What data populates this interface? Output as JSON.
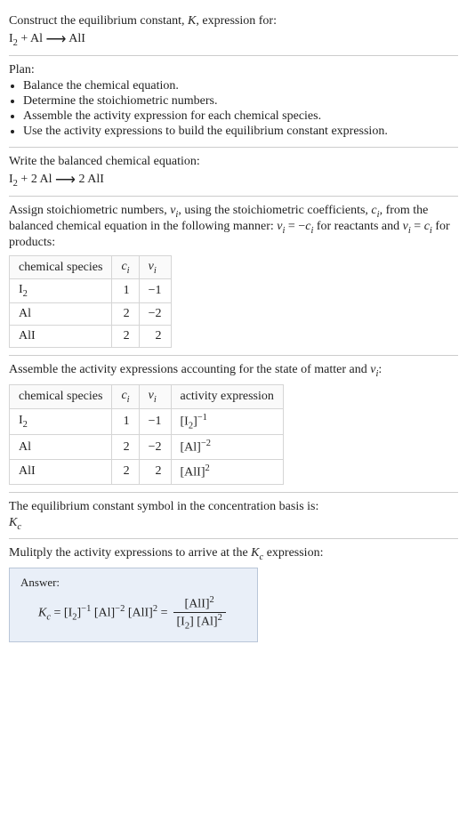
{
  "intro": {
    "line1": "Construct the equilibrium constant, ",
    "K": "K",
    "line1b": ", expression for:",
    "eq_lhs_I2": "I",
    "eq_lhs_sub2": "2",
    "plus": " + ",
    "Al": "Al",
    "arrow": "⟶",
    "AlI": "AlI"
  },
  "plan": {
    "header": "Plan:",
    "items": [
      "Balance the chemical equation.",
      "Determine the stoichiometric numbers.",
      "Assemble the activity expression for each chemical species.",
      "Use the activity expressions to build the equilibrium constant expression."
    ]
  },
  "balanced": {
    "header": "Write the balanced chemical equation:",
    "I": "I",
    "sub2": "2",
    "plus": " + 2 Al ",
    "arrow": "⟶",
    "rhs": " 2 AlI"
  },
  "assign": {
    "text1": "Assign stoichiometric numbers, ",
    "nu": "ν",
    "sub_i": "i",
    "text2": ", using the stoichiometric coefficients, ",
    "c": "c",
    "text3": ", from the balanced chemical equation in the following manner: ",
    "eq_react": " = −",
    "text4": " for reactants and ",
    "eq_prod": " = ",
    "text5": " for products:"
  },
  "table1": {
    "h_species": "chemical species",
    "h_c": "c",
    "h_nu": "ν",
    "sub_i": "i",
    "rows": [
      {
        "sp_main": "I",
        "sp_sub": "2",
        "c": "1",
        "nu": "−1"
      },
      {
        "sp_main": "Al",
        "sp_sub": "",
        "c": "2",
        "nu": "−2"
      },
      {
        "sp_main": "AlI",
        "sp_sub": "",
        "c": "2",
        "nu": "2"
      }
    ]
  },
  "assemble": {
    "text1": "Assemble the activity expressions accounting for the state of matter and ",
    "nu": "ν",
    "sub_i": "i",
    "colon": ":"
  },
  "table2": {
    "h_species": "chemical species",
    "h_c": "c",
    "h_nu": "ν",
    "h_act": "activity expression",
    "sub_i": "i",
    "rows": [
      {
        "sp_main": "I",
        "sp_sub": "2",
        "c": "1",
        "nu": "−1",
        "act_main": "[I",
        "act_sub": "2",
        "act_mid": "]",
        "act_sup": "−1"
      },
      {
        "sp_main": "Al",
        "sp_sub": "",
        "c": "2",
        "nu": "−2",
        "act_main": "[Al]",
        "act_sub": "",
        "act_mid": "",
        "act_sup": "−2"
      },
      {
        "sp_main": "AlI",
        "sp_sub": "",
        "c": "2",
        "nu": "2",
        "act_main": "[AlI]",
        "act_sub": "",
        "act_mid": "",
        "act_sup": "2"
      }
    ]
  },
  "symbol": {
    "text": "The equilibrium constant symbol in the concentration basis is:",
    "K": "K",
    "sub_c": "c"
  },
  "multiply": {
    "text1": "Mulitply the activity expressions to arrive at the ",
    "K": "K",
    "sub_c": "c",
    "text2": " expression:"
  },
  "answer": {
    "label": "Answer:",
    "Kc_K": "K",
    "Kc_sub": "c",
    "eq": " = ",
    "t1": "[I",
    "t1sub": "2",
    "t1b": "]",
    "t1sup": "−1",
    "sp": " ",
    "t2": "[Al]",
    "t2sup": "−2",
    "t3": "[AlI]",
    "t3sup": "2",
    "eq2": " = ",
    "frac_num": "[AlI]",
    "frac_num_sup": "2",
    "frac_den_a": "[I",
    "frac_den_a_sub": "2",
    "frac_den_a2": "] [Al]",
    "frac_den_sup": "2"
  }
}
